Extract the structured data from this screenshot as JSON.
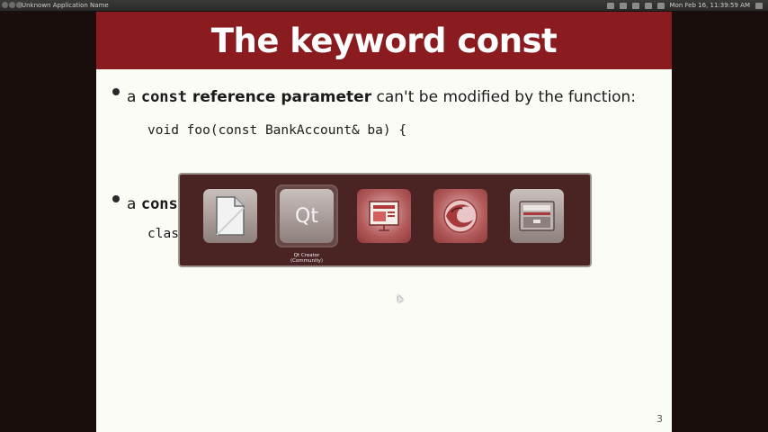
{
  "topbar": {
    "app_name": "Unknown Application Name",
    "clock": "Mon Feb 16, 11:39:59 AM"
  },
  "slide": {
    "title": "The keyword const",
    "bullet1": {
      "prefix": "a ",
      "code_word": "const",
      "bold_text": " reference parameter",
      "rest": " can't be modified by the function:"
    },
    "code1": "void foo(const BankAccount& ba) {",
    "bullet2": {
      "prefix": "a ",
      "code_word": "cons"
    },
    "code2": "clas",
    "page_number": "3"
  },
  "switcher": {
    "items": [
      {
        "icon": "libreoffice-icon"
      },
      {
        "icon": "qt-creator-icon",
        "text": "Qt"
      },
      {
        "icon": "impress-presentation-icon"
      },
      {
        "icon": "firefox-icon"
      },
      {
        "icon": "files-drawer-icon"
      }
    ],
    "selected_label": "Qt Creator (Community)",
    "colors": {
      "overlay": "#3c1212",
      "title_bar": "#8a1c1f"
    }
  }
}
